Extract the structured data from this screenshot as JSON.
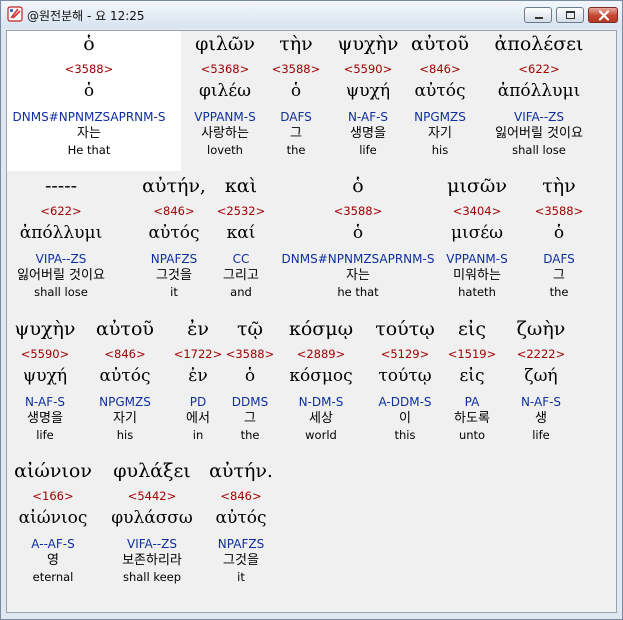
{
  "window": {
    "title": "@원전분해 - 요 12:25"
  },
  "icons": {
    "app": "bible-app-icon",
    "minimize": "minimize-icon",
    "maximize": "maximize-icon",
    "close": "close-icon"
  },
  "colors": {
    "strong": "#a00000",
    "parse": "#0e2f9f",
    "highlight_bg": "#ffffff",
    "pane_bg": "#f0f0f0"
  },
  "rows": [
    {
      "words": [
        {
          "greek": "ὁ",
          "strong": "<3588>",
          "lemma": "ὁ",
          "parse": "DNMS#NPNMZSAPRNM-S",
          "korean": "자는",
          "english": "He that",
          "highlighted": true
        },
        {
          "greek": "φιλῶν",
          "strong": "<5368>",
          "lemma": "φιλέω",
          "parse": "VPPANM-S",
          "korean": "사랑하는",
          "english": "loveth"
        },
        {
          "greek": "τὴν",
          "strong": "<3588>",
          "lemma": "ὁ",
          "parse": "DAFS",
          "korean": "그",
          "english": "the"
        },
        {
          "greek": "ψυχὴν",
          "strong": "<5590>",
          "lemma": "ψυχή",
          "parse": "N-AF-S",
          "korean": "생명을",
          "english": "life"
        },
        {
          "greek": "αὐτοῦ",
          "strong": "<846>",
          "lemma": "αὐτός",
          "parse": "NPGMZS",
          "korean": "자기",
          "english": "his"
        },
        {
          "greek": "ἀπολέσει",
          "strong": "<622>",
          "lemma": "ἀπόλλυμι",
          "parse": "VIFA--ZS",
          "korean": "잃어버릴 것이요",
          "english": "shall lose"
        }
      ]
    },
    {
      "words": [
        {
          "greek": "-----",
          "strong": "<622>",
          "lemma": "ἀπόλλυμι",
          "parse": "VIPA--ZS",
          "korean": "잃어버릴 것이요",
          "english": "shall lose"
        },
        {
          "greek": "αὐτήν,",
          "strong": "<846>",
          "lemma": "αὐτός",
          "parse": "NPAFZS",
          "korean": "그것을",
          "english": "it"
        },
        {
          "greek": "καὶ",
          "strong": "<2532>",
          "lemma": "καί",
          "parse": "CC",
          "korean": "그리고",
          "english": "and"
        },
        {
          "greek": "ὁ",
          "strong": "<3588>",
          "lemma": "ὁ",
          "parse": "DNMS#NPNMZSAPRNM-S",
          "korean": "자는",
          "english": "he that"
        },
        {
          "greek": "μισῶν",
          "strong": "<3404>",
          "lemma": "μισέω",
          "parse": "VPPANM-S",
          "korean": "미워하는",
          "english": "hateth"
        },
        {
          "greek": "τὴν",
          "strong": "<3588>",
          "lemma": "ὁ",
          "parse": "DAFS",
          "korean": "그",
          "english": "the"
        }
      ]
    },
    {
      "words": [
        {
          "greek": "ψυχὴν",
          "strong": "<5590>",
          "lemma": "ψυχή",
          "parse": "N-AF-S",
          "korean": "생명을",
          "english": "life"
        },
        {
          "greek": "αὐτοῦ",
          "strong": "<846>",
          "lemma": "αὐτός",
          "parse": "NPGMZS",
          "korean": "자기",
          "english": "his"
        },
        {
          "greek": "ἐν",
          "strong": "<1722>",
          "lemma": "ἐν",
          "parse": "PD",
          "korean": "에서",
          "english": "in"
        },
        {
          "greek": "τῷ",
          "strong": "<3588>",
          "lemma": "ὁ",
          "parse": "DDMS",
          "korean": "그",
          "english": "the"
        },
        {
          "greek": "κόσμῳ",
          "strong": "<2889>",
          "lemma": "κόσμος",
          "parse": "N-DM-S",
          "korean": "세상",
          "english": "world"
        },
        {
          "greek": "τούτῳ",
          "strong": "<5129>",
          "lemma": "τούτῳ",
          "parse": "A-DDM-S",
          "korean": "이",
          "english": "this"
        },
        {
          "greek": "εἰς",
          "strong": "<1519>",
          "lemma": "εἰς",
          "parse": "PA",
          "korean": "하도록",
          "english": "unto"
        },
        {
          "greek": "ζωὴν",
          "strong": "<2222>",
          "lemma": "ζωή",
          "parse": "N-AF-S",
          "korean": "생",
          "english": "life"
        }
      ]
    },
    {
      "words": [
        {
          "greek": "αἰώνιον",
          "strong": "<166>",
          "lemma": "αἰώνιος",
          "parse": "A--AF-S",
          "korean": "영",
          "english": "eternal"
        },
        {
          "greek": "φυλάξει",
          "strong": "<5442>",
          "lemma": "φυλάσσω",
          "parse": "VIFA--ZS",
          "korean": "보존하리라",
          "english": "shall keep"
        },
        {
          "greek": "αὐτήν.",
          "strong": "<846>",
          "lemma": "αὐτός",
          "parse": "NPAFZS",
          "korean": "그것을",
          "english": "it"
        }
      ]
    }
  ]
}
